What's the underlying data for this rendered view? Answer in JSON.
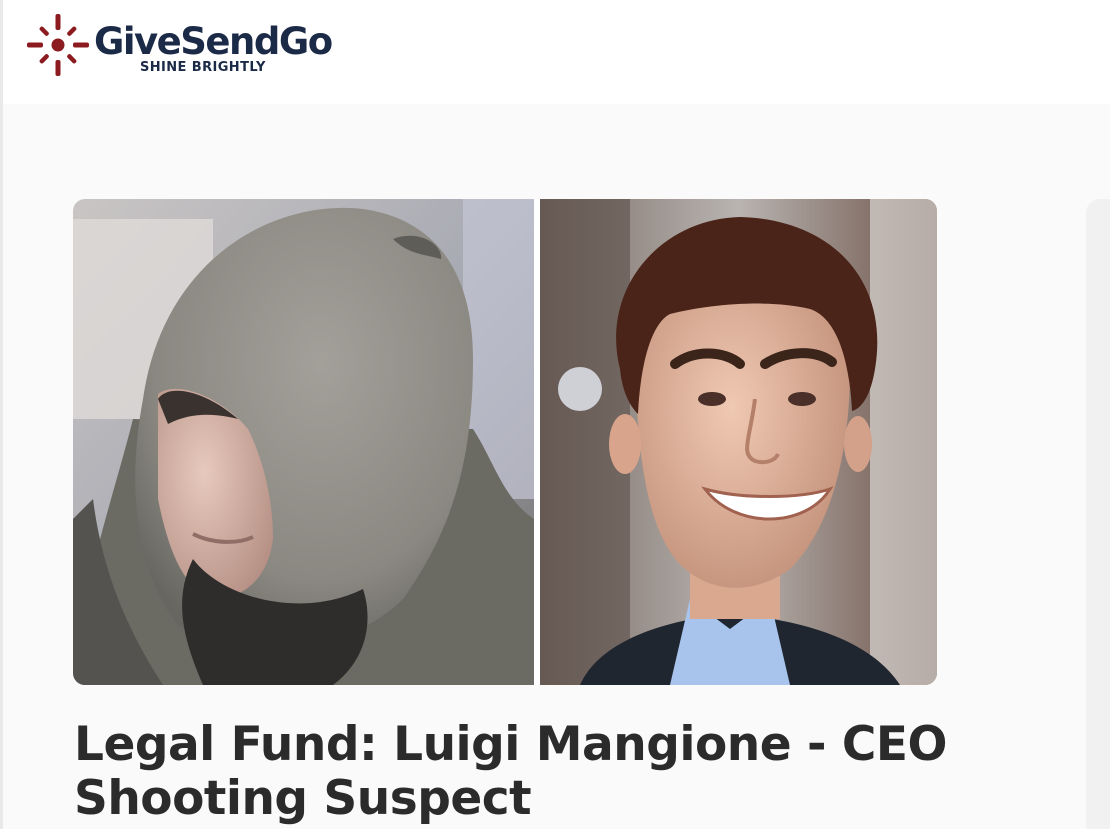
{
  "brand": {
    "name": "GiveSendGo",
    "tagline": "SHINE BRIGHTLY",
    "mark_icon": "sun-burst-logo-icon",
    "colors": {
      "mark": "#8c1b1f",
      "wordmark": "#1b2a47"
    }
  },
  "campaign": {
    "title": "Legal Fund: Luigi Mangione - CEO Shooting Suspect",
    "images": [
      {
        "semantic": "hooded-person-surveillance-photo"
      },
      {
        "semantic": "smiling-man-portrait-photo"
      }
    ]
  },
  "colors": {
    "page_bg": "#fafafa",
    "header_bg": "#ffffff",
    "title_text": "#2b2b2b"
  }
}
